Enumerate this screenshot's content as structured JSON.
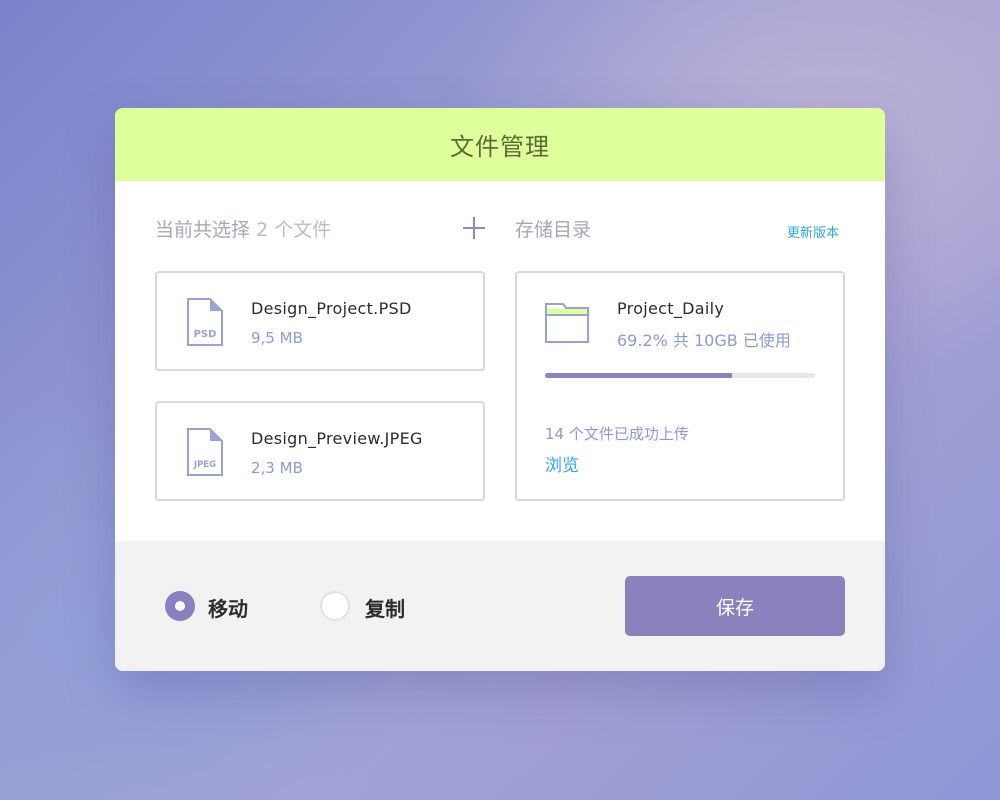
{
  "dialog": {
    "title": "文件管理"
  },
  "selection": {
    "label_prefix": "当前共选择",
    "count_text": "2 个文件",
    "add_icon": "plus-icon"
  },
  "files": [
    {
      "name": "Design_Project.PSD",
      "size": "9,5 MB",
      "type_label": "PSD",
      "icon": "psd-file-icon"
    },
    {
      "name": "Design_Preview.JPEG",
      "size": "2,3 MB",
      "type_label": "JPEG",
      "icon": "jpeg-file-icon"
    }
  ],
  "storage": {
    "label": "存储目录",
    "update_link": "更新版本",
    "folder_name": "Project_Daily",
    "folder_icon": "folder-icon",
    "usage_text": "69.2% 共 10GB 已使用",
    "usage_fraction": 0.692,
    "upload_status": "14 个文件已成功上传",
    "browse_link": "浏览"
  },
  "footer": {
    "options": [
      {
        "label": "移动",
        "checked": true
      },
      {
        "label": "复制",
        "checked": false
      }
    ],
    "save_label": "保存"
  },
  "colors": {
    "header_bg": "#dfff9c",
    "accent": "#8a82bf",
    "link": "#2fa6e6",
    "muted_text": "#8e9ad2"
  }
}
